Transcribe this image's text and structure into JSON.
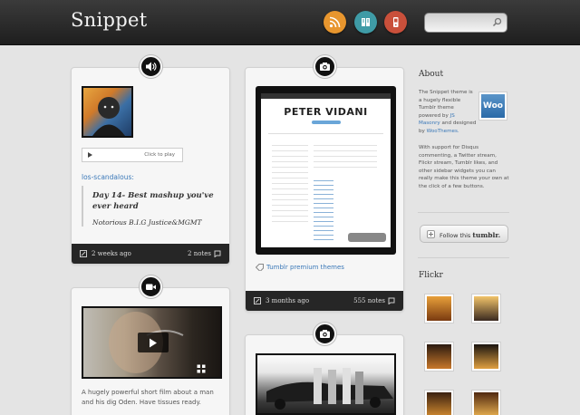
{
  "header": {
    "logo": "Snippet",
    "rss_icon": "rss-icon",
    "book_icon": "book-icon",
    "phone_icon": "phone-icon",
    "search_placeholder": "",
    "colors": {
      "rss": "#e8962e",
      "book": "#3f9ba6",
      "phone": "#c9503b"
    }
  },
  "posts": {
    "audio": {
      "type_icon": "speaker-icon",
      "player_label": "Click to play",
      "username": "los-scandalous:",
      "quote_title": "Day 14- Best mashup you've ever heard",
      "quote_author": "Notorious B.I.G Justice&MGMT",
      "time": "2 weeks ago",
      "notes": "2 notes"
    },
    "photo": {
      "type_icon": "camera-icon",
      "screenshot_title": "PETER VIDANI",
      "tag": "Tumblr premium themes",
      "time": "3 months ago",
      "notes": "555 notes"
    },
    "video": {
      "type_icon": "video-camera-icon",
      "description": "A hugely powerful short film about a man and his dig Oden. Have tissues ready."
    },
    "photo2": {
      "type_icon": "camera-icon"
    }
  },
  "sidebar": {
    "about_title": "About",
    "about_text_1": "The Snippet theme is a hugely flexible Tumblr theme powered by",
    "about_link_1": "JS Masonry",
    "about_text_2": "and designed by",
    "about_link_2": "WooThemes.",
    "about_text_3": "With support for Disqus commenting, a Twitter stream, Flickr stream, Tumblr likes, and other sidebar widgets you can really make this theme your own at the click of a few buttons.",
    "woo_logo": "Woo",
    "follow_prefix": "Follow this",
    "follow_brand": "tumblr.",
    "flickr_title": "Flickr"
  }
}
